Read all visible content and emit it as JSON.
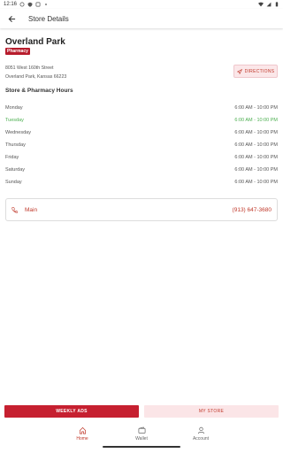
{
  "status_bar": {
    "time": "12:16"
  },
  "app_bar": {
    "title": "Store Details"
  },
  "store": {
    "name": "Overland Park",
    "badge": "Pharmacy",
    "address_line1": "8051 West 160th Street",
    "address_line2": "Overland Park, Kansas 66223",
    "directions_label": "DIRECTIONS"
  },
  "hours": {
    "title": "Store & Pharmacy Hours",
    "rows": [
      {
        "day": "Monday",
        "time": "6:00 AM - 10:00 PM"
      },
      {
        "day": "Tuesday",
        "time": "6:00 AM - 10:00 PM"
      },
      {
        "day": "Wednesday",
        "time": "6:00 AM - 10:00 PM"
      },
      {
        "day": "Thursday",
        "time": "6:00 AM - 10:00 PM"
      },
      {
        "day": "Friday",
        "time": "6:00 AM - 10:00 PM"
      },
      {
        "day": "Saturday",
        "time": "6:00 AM - 10:00 PM"
      },
      {
        "day": "Sunday",
        "time": "6:00 AM - 10:00 PM"
      }
    ],
    "today": "Tuesday"
  },
  "phone": {
    "label": "Main",
    "number": "(913) 647-3680"
  },
  "buttons": {
    "weekly_ads": "WEEKLY ADS",
    "my_store": "MY STORE"
  },
  "nav": {
    "items": [
      {
        "label": "Home",
        "icon": "home-icon",
        "active": true
      },
      {
        "label": "Wallet",
        "icon": "wallet-icon",
        "active": false
      },
      {
        "label": "Account",
        "icon": "account-icon",
        "active": false
      }
    ]
  },
  "colors": {
    "brand": "#c62030",
    "today": "#4caf50",
    "accent_text": "#c0392b",
    "light_brand": "#fbe5e7"
  }
}
